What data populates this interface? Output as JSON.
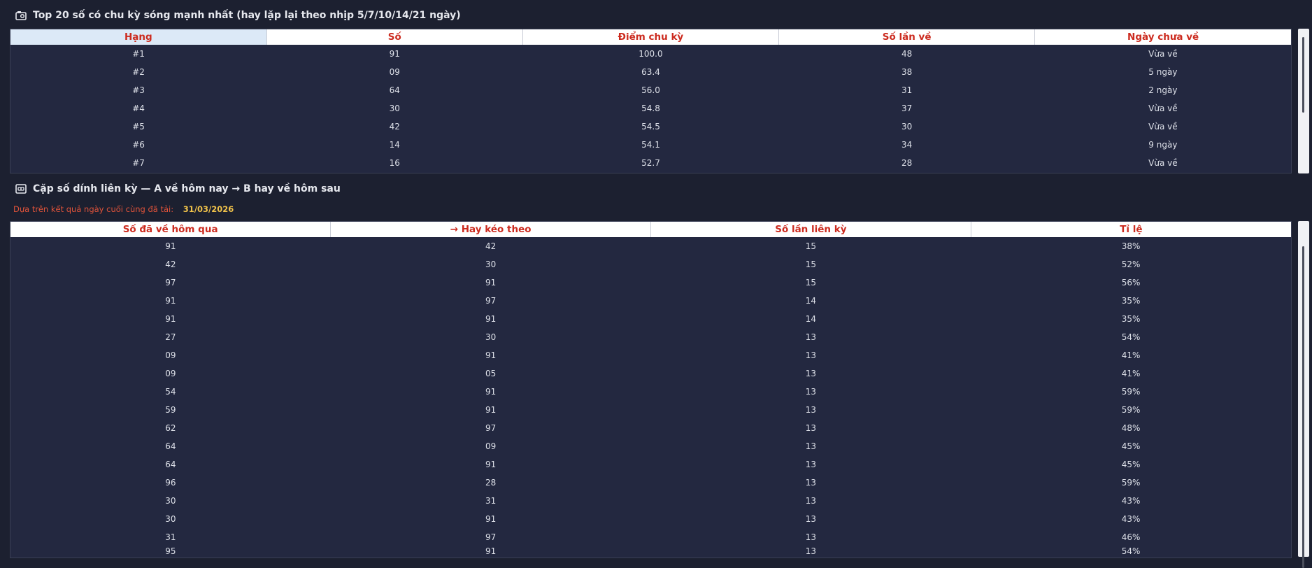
{
  "section1": {
    "title": "Top 20 số có chu kỳ sóng mạnh nhất (hay lặp lại theo nhịp 5/7/10/14/21 ngày)",
    "icon": "camera-icon",
    "columns": [
      "Hạng",
      "Số",
      "Điểm chu kỳ",
      "Số lần về",
      "Ngày chưa về"
    ],
    "rows": [
      [
        "#1",
        "91",
        "100.0",
        "48",
        "Vừa về"
      ],
      [
        "#2",
        "09",
        "63.4",
        "38",
        "5 ngày"
      ],
      [
        "#3",
        "64",
        "56.0",
        "31",
        "2 ngày"
      ],
      [
        "#4",
        "30",
        "54.8",
        "37",
        "Vừa về"
      ],
      [
        "#5",
        "42",
        "54.5",
        "30",
        "Vừa về"
      ],
      [
        "#6",
        "14",
        "54.1",
        "34",
        "9 ngày"
      ],
      [
        "#7",
        "16",
        "52.7",
        "28",
        "Vừa về"
      ]
    ]
  },
  "section2": {
    "title": "Cặp số dính liên kỳ — A về hôm nay → B hay về hôm sau",
    "icon": "link-icon",
    "note_label": "Dựa trên kết quả ngày cuối cùng đã tải:",
    "note_date": "31/03/2026",
    "columns": [
      "Số đã về hôm qua",
      "→  Hay kéo theo",
      "Số lần liên kỳ",
      "Tỉ lệ"
    ],
    "rows": [
      [
        "91",
        "42",
        "15",
        "38%"
      ],
      [
        "42",
        "30",
        "15",
        "52%"
      ],
      [
        "97",
        "91",
        "15",
        "56%"
      ],
      [
        "91",
        "97",
        "14",
        "35%"
      ],
      [
        "91",
        "91",
        "14",
        "35%"
      ],
      [
        "27",
        "30",
        "13",
        "54%"
      ],
      [
        "09",
        "91",
        "13",
        "41%"
      ],
      [
        "09",
        "05",
        "13",
        "41%"
      ],
      [
        "54",
        "91",
        "13",
        "59%"
      ],
      [
        "59",
        "91",
        "13",
        "59%"
      ],
      [
        "62",
        "97",
        "13",
        "48%"
      ],
      [
        "64",
        "09",
        "13",
        "45%"
      ],
      [
        "64",
        "91",
        "13",
        "45%"
      ],
      [
        "96",
        "28",
        "13",
        "59%"
      ],
      [
        "30",
        "31",
        "13",
        "43%"
      ],
      [
        "30",
        "91",
        "13",
        "43%"
      ],
      [
        "31",
        "97",
        "13",
        "46%"
      ],
      [
        "95",
        "91",
        "13",
        "54%"
      ]
    ]
  },
  "colors": {
    "background": "#1c2030",
    "table_body": "#232840",
    "header_text": "#cc2b1f",
    "note_text": "#e0533a",
    "note_date": "#f0c24a"
  }
}
